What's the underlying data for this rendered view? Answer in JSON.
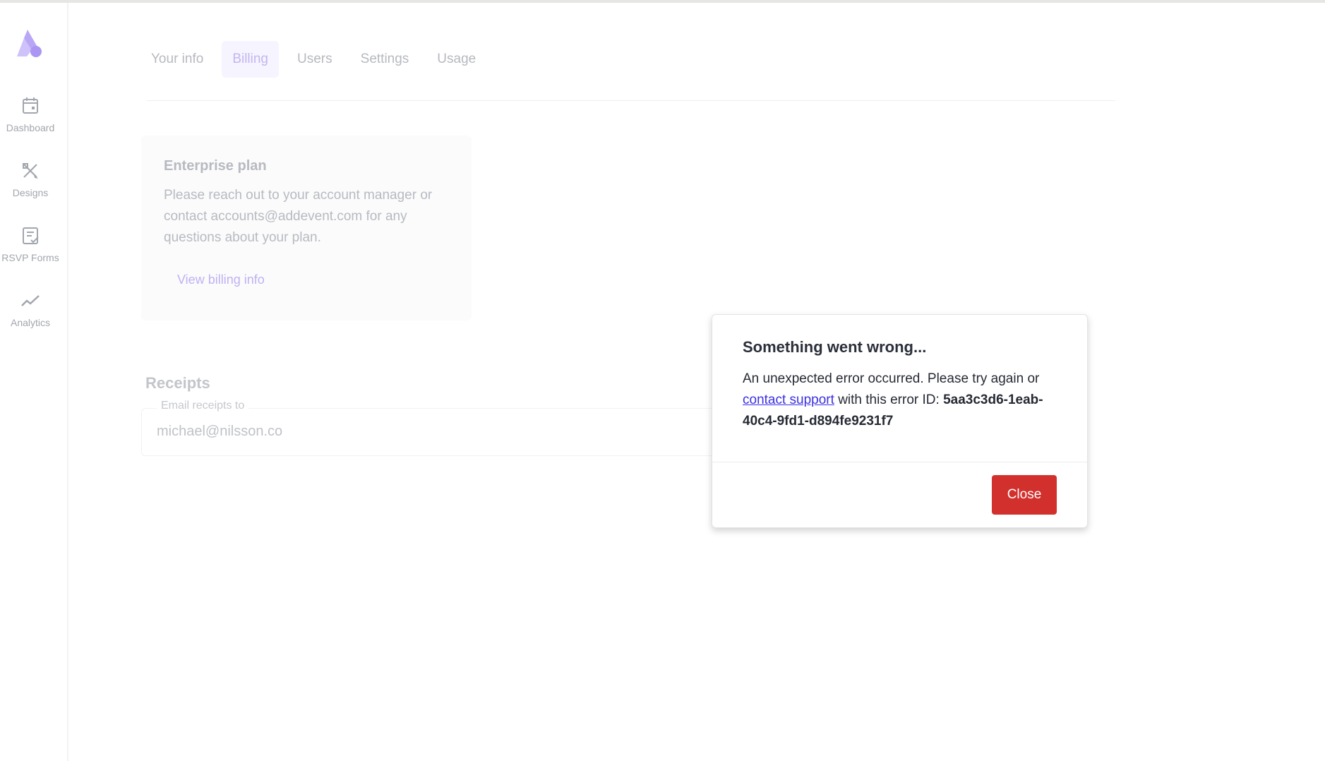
{
  "sidebar": {
    "items": [
      {
        "label": "Dashboard",
        "icon": "calendar-icon"
      },
      {
        "label": "Designs",
        "icon": "design-tools-icon"
      },
      {
        "label": "RSVP Forms",
        "icon": "checklist-icon"
      },
      {
        "label": "Analytics",
        "icon": "trend-line-icon"
      }
    ]
  },
  "tabs": [
    {
      "label": "Your info",
      "active": false
    },
    {
      "label": "Billing",
      "active": true
    },
    {
      "label": "Users",
      "active": false
    },
    {
      "label": "Settings",
      "active": false
    },
    {
      "label": "Usage",
      "active": false
    }
  ],
  "plan": {
    "title": "Enterprise plan",
    "description": "Please reach out to your account manager or contact accounts@addevent.com for any questions about your plan.",
    "link": "View billing info"
  },
  "receipts": {
    "title": "Receipts",
    "field_label": "Email receipts to",
    "field_value": "michael@nilsson.co"
  },
  "modal": {
    "title": "Something went wrong...",
    "message_before": "An unexpected error occurred. Please try again or ",
    "link_text": "contact support",
    "message_after": " with this error ID: ",
    "error_id": "5aa3c3d6-1eab-40c4-9fd1-d894fe9231f7",
    "close_label": "Close"
  },
  "colors": {
    "brand": "#b9a7f6",
    "danger": "#d2302d",
    "link": "#3b30e3"
  }
}
